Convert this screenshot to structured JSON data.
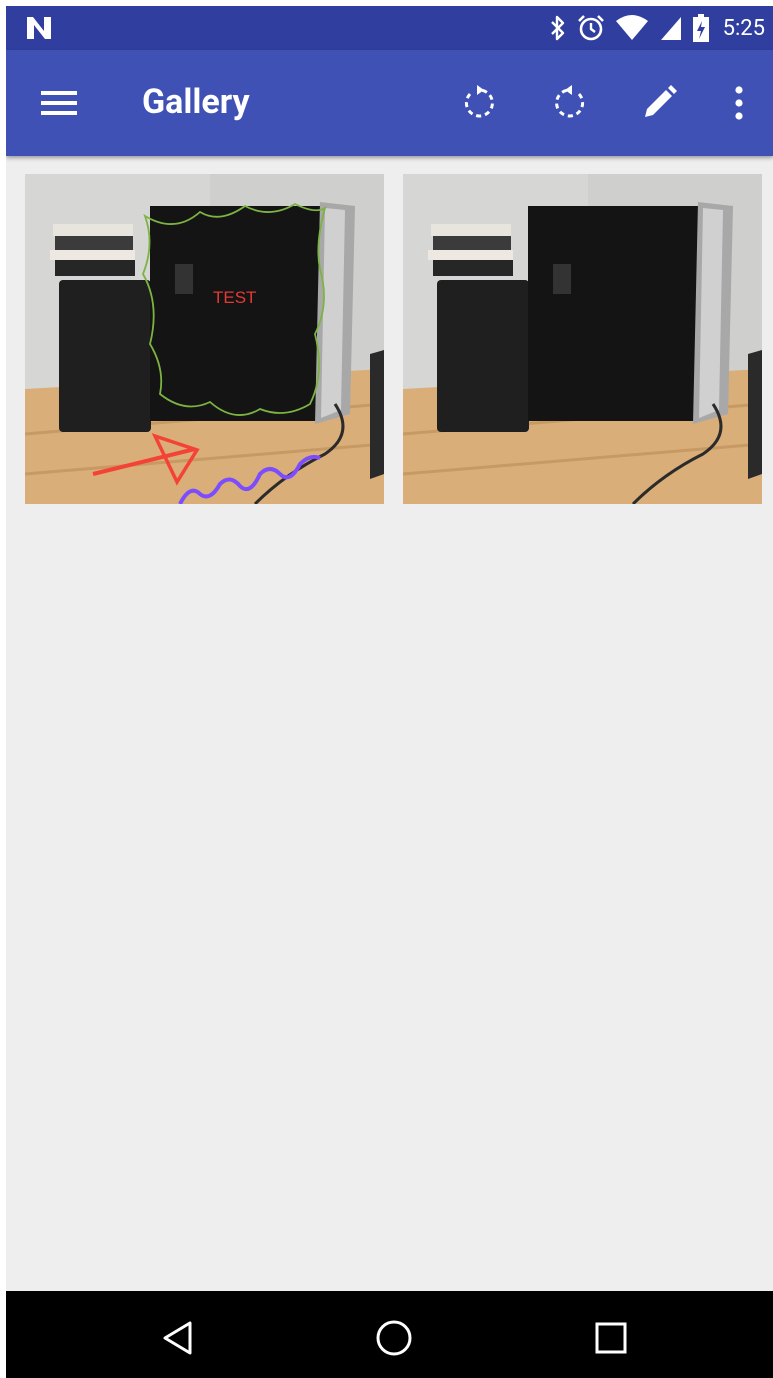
{
  "status_bar": {
    "time": "5:25",
    "icons": [
      "notification-n-icon",
      "bluetooth-icon",
      "alarm-icon",
      "wifi-icon",
      "signal-icon",
      "battery-charging-icon"
    ]
  },
  "toolbar": {
    "title": "Gallery",
    "buttons": [
      "menu-icon",
      "rotate-left-icon",
      "rotate-right-icon",
      "edit-icon",
      "more-vert-icon"
    ]
  },
  "gallery": {
    "photos": [
      {
        "annotation_text": "TEST",
        "annotated": true
      },
      {
        "annotated": false
      }
    ]
  },
  "colors": {
    "status_bar": "#303f9f",
    "toolbar": "#3f51b5",
    "background": "#eeeeee",
    "annotation_text": "#e53935",
    "annotation_outline": "#7cb342",
    "annotation_arrow": "#f44336",
    "annotation_squiggle": "#7c4dff"
  }
}
